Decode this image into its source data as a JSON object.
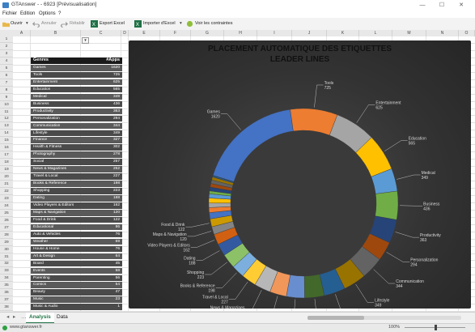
{
  "window": {
    "title": "GTAnswer - - 6923 [Prévisualisation]",
    "minimize": "—",
    "maximize": "☐",
    "close": "✕"
  },
  "menu": [
    "Fichier",
    "Edition",
    "Options",
    "?"
  ],
  "toolbar": {
    "open": "Ouvrir",
    "undo": "Annuler",
    "redo": "Rétablir",
    "export_excel": "Export Excel",
    "import_excel": "Importer d'Excel",
    "view_constraints": "Voir les contraintes"
  },
  "columns": [
    "A",
    "B",
    "C",
    "D",
    "E",
    "F",
    "G",
    "H",
    "I",
    "J",
    "K",
    "L",
    "M",
    "N",
    "O"
  ],
  "rows": [
    "1",
    "2",
    "3",
    "4",
    "5",
    "6",
    "7",
    "8",
    "9",
    "10",
    "11",
    "12",
    "13",
    "14",
    "15",
    "16",
    "17",
    "18",
    "19",
    "20",
    "21",
    "22",
    "23",
    "24",
    "25",
    "26",
    "27",
    "28",
    "29",
    "30",
    "31",
    "32",
    "33",
    "34",
    "35",
    "36",
    "37",
    "38"
  ],
  "table": {
    "header": {
      "name": "Genres",
      "value": "#Apps"
    },
    "rows": [
      {
        "name": "Games",
        "value": "1620"
      },
      {
        "name": "Tools",
        "value": "725"
      },
      {
        "name": "Entertainment",
        "value": "625"
      },
      {
        "name": "Education",
        "value": "565"
      },
      {
        "name": "Medical",
        "value": "349"
      },
      {
        "name": "Business",
        "value": "436"
      },
      {
        "name": "Productivity",
        "value": "363"
      },
      {
        "name": "Personalization",
        "value": "294"
      },
      {
        "name": "Communication",
        "value": "344"
      },
      {
        "name": "Lifestyle",
        "value": "349"
      },
      {
        "name": "Finance",
        "value": "327"
      },
      {
        "name": "Health & Fitness",
        "value": "302"
      },
      {
        "name": "Photography",
        "value": "278"
      },
      {
        "name": "Social",
        "value": "257"
      },
      {
        "name": "News & Magazines",
        "value": "252"
      },
      {
        "name": "Travel & Local",
        "value": "227"
      },
      {
        "name": "Books & Reference",
        "value": "198"
      },
      {
        "name": "Shopping",
        "value": "223"
      },
      {
        "name": "Dating",
        "value": "188"
      },
      {
        "name": "Video Players & Editors",
        "value": "162"
      },
      {
        "name": "Maps & Navigation",
        "value": "120"
      },
      {
        "name": "Food & Drink",
        "value": "122"
      },
      {
        "name": "Educational",
        "value": "96"
      },
      {
        "name": "Auto & Vehicles",
        "value": "76"
      },
      {
        "name": "Weather",
        "value": "69"
      },
      {
        "name": "House & Home",
        "value": "76"
      },
      {
        "name": "Art & Design",
        "value": "64"
      },
      {
        "name": "Board",
        "value": "45"
      },
      {
        "name": "Events",
        "value": "58"
      },
      {
        "name": "Parenting",
        "value": "56"
      },
      {
        "name": "Comics",
        "value": "54"
      },
      {
        "name": "Beauty",
        "value": "47"
      },
      {
        "name": "Music",
        "value": "23"
      },
      {
        "name": "Music & Audio",
        "value": "1"
      }
    ]
  },
  "chart_data": {
    "type": "pie",
    "title": "PLACEMENT AUTOMATIQUE DES ETIQUETTES",
    "subtitle": "LEADER LINES",
    "categories": [
      "Games",
      "Tools",
      "Entertainment",
      "Education",
      "Medical",
      "Business",
      "Productivity",
      "Personalization",
      "Communication",
      "Lifestyle",
      "Finance",
      "Health & Fitness",
      "Photography",
      "Social",
      "News & Magazines",
      "Travel & Local",
      "Books & Reference",
      "Shopping",
      "Dating",
      "Video Players & Editors",
      "Maps & Navigation",
      "Food & Drink",
      "Educational",
      "Auto & Vehicles",
      "Weather",
      "House & Home",
      "Art & Design",
      "Board",
      "Events",
      "Parenting",
      "Comics",
      "Beauty",
      "Music",
      "Music & Audio"
    ],
    "values": [
      1620,
      725,
      625,
      565,
      349,
      436,
      363,
      294,
      344,
      349,
      327,
      302,
      278,
      257,
      252,
      227,
      198,
      223,
      188,
      162,
      120,
      122,
      96,
      76,
      69,
      76,
      64,
      45,
      58,
      56,
      54,
      47,
      23,
      1
    ],
    "labeled_slices": [
      "Games",
      "Tools",
      "Entertainment",
      "Education",
      "Medical",
      "Business",
      "Productivity",
      "Personalization",
      "Communication",
      "Lifestyle",
      "Finance",
      "Health & Fitness",
      "Photography",
      "Social",
      "News & Magazines",
      "Travel & Local",
      "Books & Reference",
      "Shopping",
      "Dating",
      "Video Players & Editors",
      "Maps & Navigation",
      "Food & Drink"
    ],
    "colors": [
      "#4472c4",
      "#ed7d31",
      "#a5a5a5",
      "#ffc000",
      "#5b9bd5",
      "#70ad47",
      "#264478",
      "#9e480e",
      "#636363",
      "#997300",
      "#255e91",
      "#43682b",
      "#698ed0",
      "#f1975a",
      "#b7b7b7",
      "#ffcd33",
      "#7cafdd",
      "#8cc168",
      "#335aa1",
      "#d26012",
      "#848484",
      "#cc9a00"
    ]
  },
  "sheets": [
    "Analysis",
    "Data"
  ],
  "status": {
    "left": "www.gtanswer.fr",
    "zoom": "100%"
  }
}
